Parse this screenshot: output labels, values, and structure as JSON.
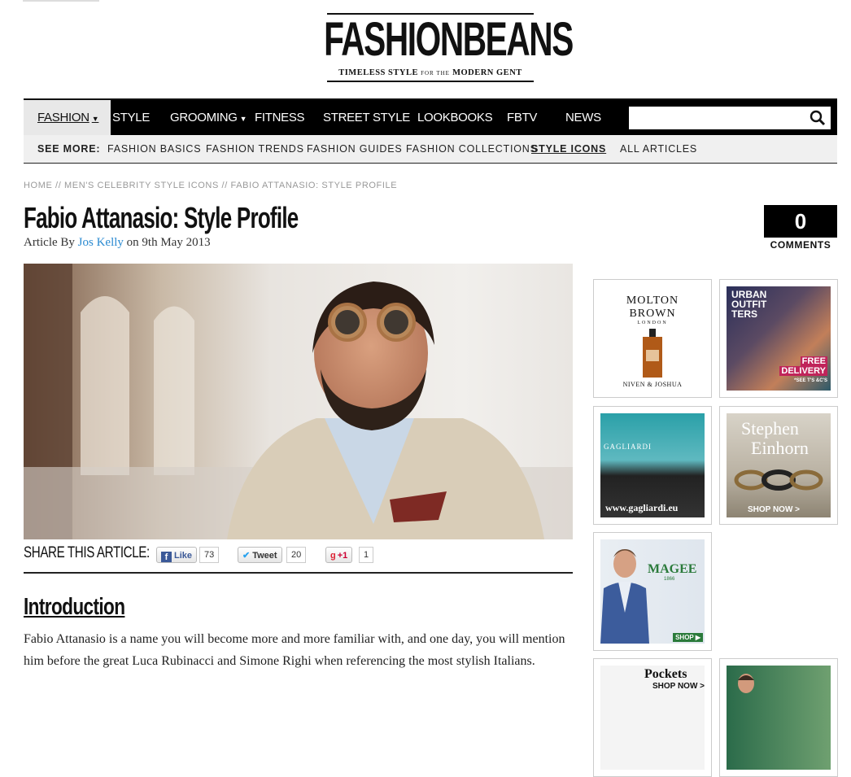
{
  "logo": {
    "name": "FASHIONBEANS",
    "tagline_left": "TIMELESS STYLE",
    "tagline_mid": "FOR THE",
    "tagline_right": "MODERN GENT"
  },
  "nav": {
    "items": [
      "FASHION",
      "STYLE",
      "GROOMING",
      "FITNESS",
      "STREET STYLE",
      "LOOKBOOKS",
      "FBTV",
      "NEWS"
    ],
    "search_placeholder": ""
  },
  "subnav": {
    "label": "SEE MORE:",
    "items": [
      "FASHION BASICS",
      "FASHION TRENDS",
      "FASHION GUIDES",
      "FASHION COLLECTIONS",
      "STYLE ICONS",
      "ALL ARTICLES"
    ]
  },
  "breadcrumb": "HOME // MEN'S CELEBRITY STYLE ICONS // FABIO ATTANASIO: STYLE PROFILE",
  "article": {
    "title": "Fabio Attanasio: Style Profile",
    "byline_prefix": "Article By",
    "author": "Jos Kelly",
    "byline_suffix": "on 9th May 2013"
  },
  "comments": {
    "count": "0",
    "label": "COMMENTS"
  },
  "share": {
    "label": "SHARE THIS ARTICLE:",
    "like_label": "Like",
    "like_count": "73",
    "tweet_label": "Tweet",
    "tweet_count": "20",
    "gplus_label": "+1",
    "gplus_count": "1"
  },
  "intro": {
    "heading": "Introduction",
    "text": "Fabio Attanasio is a name you will become more and more familiar with, and one day, you will mention him before the great Luca Rubinacci and Simone Righi when referencing the most stylish Italians."
  },
  "ads": {
    "molton": {
      "brand_line1": "MOLTON",
      "brand_line2": "BROWN",
      "city": "LONDON",
      "product": "NIVEN & JOSHUA"
    },
    "urban": {
      "line1": "URBAN",
      "line2": "OUTFIT",
      "line3": "TERS",
      "promo1": "FREE",
      "promo2": "DELIVERY",
      "promo3": "*SEE T'S &C'S"
    },
    "gagliardi": {
      "brand": "GAGLIARDI",
      "url": "www.gagliardi.eu"
    },
    "einhorn": {
      "line1": "Stephen",
      "line2": "Einhorn",
      "cta": "SHOP NOW >"
    },
    "magee": {
      "brand": "MAGEE",
      "year": "1866",
      "cta": "SHOP ▶"
    },
    "pockets": {
      "brand": "Pockets",
      "cta": "SHOP NOW >"
    }
  },
  "colors": {
    "accent_link": "#2a8ad1",
    "nav_bg": "#000000",
    "subnav_bg": "#f0f0f0"
  }
}
